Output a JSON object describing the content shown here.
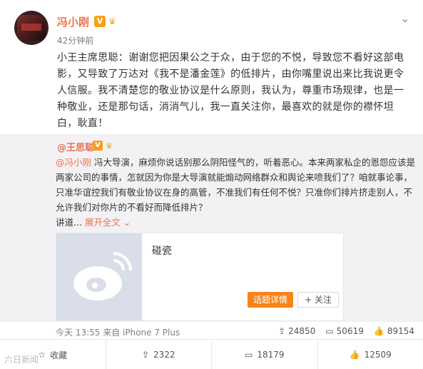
{
  "post": {
    "author": "冯小刚",
    "verified": "V",
    "time": "42分钟前",
    "text": "小王主席思聪：谢谢您把因果公之于众，由于您的不悦，导致您不看好这部电影，又导致了万达对《我不是潘金莲》的低排片，由你嘴里说出来比我说更令人信服。我不清楚您的敬业协议是什么原则，我认为，尊重市场规律，也是一种敬业，还是那句话，消消气儿，我一直关注你，最喜欢的就是你的襟怀坦白，耿直！"
  },
  "repost": {
    "author": "@王思聪",
    "verified": "V",
    "mention": "@冯小刚",
    "text": " 冯大导演，麻烦你说话别那么阴阳怪气的，听着恶心。本来两家私企的恩怨应该是两家公司的事情，怎就因为你是大导演就能煽动网络群众和舆论来喷我们了？咱就事论事，只准华谊控我们有敬业协议在身的高管，不准我们有任何不悦？只准你们排片挤走别人，不允许我们对你片的不看好而降低排片？",
    "tail": "讲道...",
    "expand_label": "展开全文",
    "card": {
      "title": "碰瓷",
      "detail_button": "话题详情",
      "follow_button": "+ 关注"
    },
    "meta": "今天 13:55 来自 iPhone 7 Plus",
    "shares": "24850",
    "comments": "50619",
    "likes": "89154"
  },
  "actions": {
    "collect": "收藏",
    "share": "2322",
    "comment": "18179",
    "like": "12509"
  },
  "watermark": "六日新闻"
}
